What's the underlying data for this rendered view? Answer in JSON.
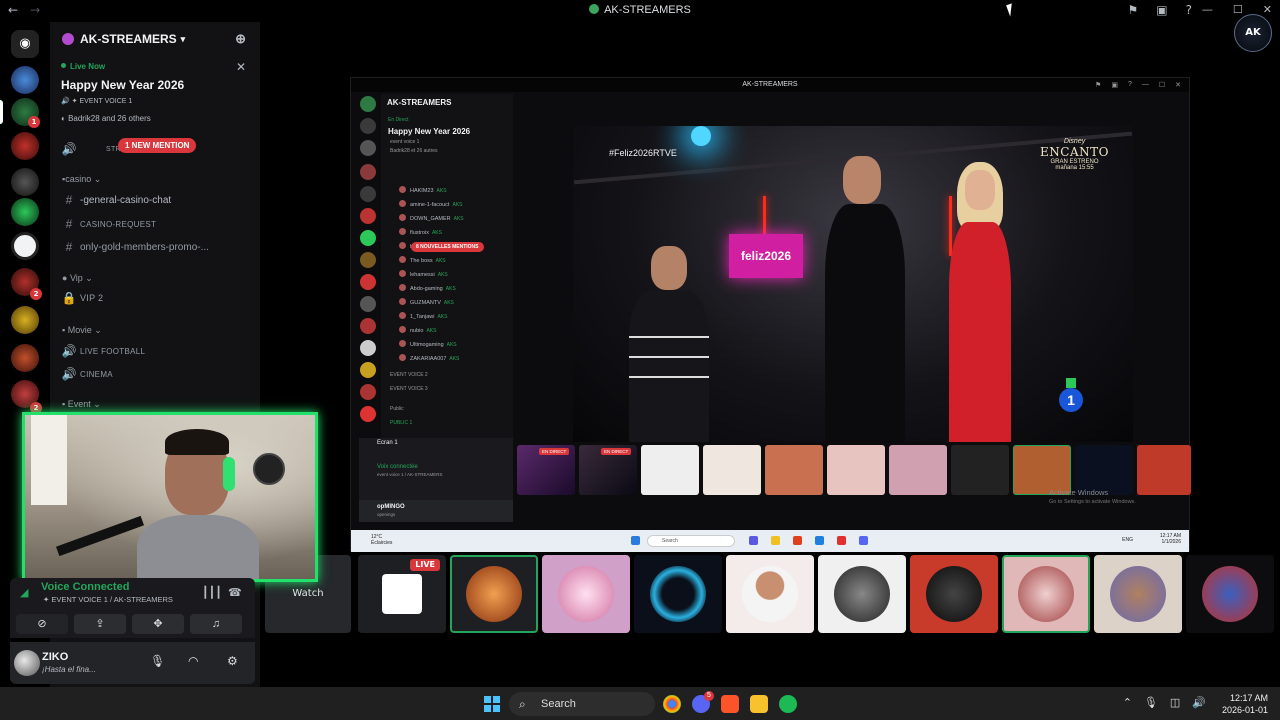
{
  "window": {
    "title": "AK-STREAMERS",
    "nav_back": "←",
    "nav_fwd": "→"
  },
  "rail": {
    "badges": [
      "1",
      "2",
      "2"
    ]
  },
  "sidebar": {
    "server_name": "AK-STREAMERS",
    "live": {
      "label": "Live Now",
      "title": "Happy New Year 2026",
      "channel": "EVENT VOICE 1",
      "participants": "Badrik28 and 26 others"
    },
    "mention_pill": "1 NEW MENTION",
    "stage_channel_prefix": "STR",
    "categories": {
      "casino": "casino",
      "vip": "Vip",
      "movie": "Movie",
      "event": "Event"
    },
    "channels": {
      "casino_chat": "-general-casino-chat",
      "casino_request": "CASINO-REQUEST",
      "gold_promo": "only-gold-members-promo-...",
      "vip2": "VIP 2",
      "live_football": "LIVE FOOTBALL",
      "cinema": "CINEMA"
    }
  },
  "voice_panel": {
    "status": "Voice Connected",
    "location": "EVENT VOICE 1 / AK-STREAMERS"
  },
  "user_panel": {
    "name": "ZIKO",
    "status": "¡Hasta el fina..."
  },
  "shared_screen": {
    "title": "AK-STREAMERS",
    "server_name": "AK-STREAMERS",
    "live_label": "En Direct",
    "event_title": "Happy New Year 2026",
    "channel": "event voice 1",
    "participants": "Badrik28 et 26 autres",
    "mention_pill": "8 NOUVELLES MENTIONS",
    "members": [
      "HAKIM23",
      "amine-1-facouct",
      "DOWN_GAMER",
      "flustroix",
      "halimi30",
      "The boss",
      "lehamessi",
      "Abdo-gaming",
      "GUZMANTV",
      "1_Tanjawi",
      "nubio",
      "Ultimogaming",
      "ZAKARIAA007"
    ],
    "member_tag": "AKS",
    "voice_channels": [
      "EVENT VOICE 2",
      "EVENT VOICE 3"
    ],
    "public_category": "Public",
    "public_channel": "PUBLIC 1",
    "screen_share_title": "Ecran 1",
    "voice_status": "Voix connectée",
    "voice_location": "event voice 1 / AK-STREAMERS",
    "username": "opMINGO",
    "user_status": "openings",
    "live_badge": "EN DIRECT",
    "activate_title": "Activate Windows",
    "activate_sub": "Go to Settings to activate Windows.",
    "taskbar_weather": "12°C",
    "taskbar_weather_sub": "Éclaircies",
    "taskbar_search": "Search",
    "taskbar_lang": "ENG",
    "taskbar_time": "12:17 AM",
    "taskbar_date": "1/1/2026"
  },
  "video": {
    "hashtag": "#Feliz2026RTVE",
    "brand_small": "Disney",
    "brand_title": "ENCANTO",
    "brand_sub": "GRAN ESTRENO",
    "brand_time": "mañana 15:55",
    "screen_text": "feliz2026",
    "channel_number": "1"
  },
  "tiles": {
    "watch_label": "Watch",
    "live_badge": "LIVE"
  },
  "taskbar": {
    "search": "Search",
    "time": "12:17 AM",
    "date": "2026-01-01",
    "discord_badge": "5"
  },
  "corner_badge": "AK",
  "colors": {
    "accent_green": "#23a55a",
    "mention_red": "#da373c",
    "webcam_border": "#22e06a"
  }
}
